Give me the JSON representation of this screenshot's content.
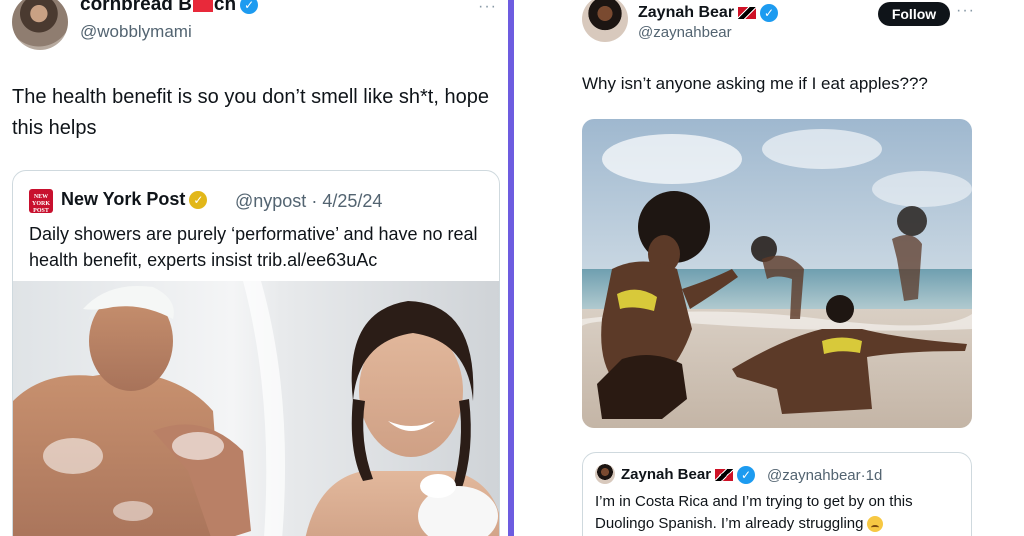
{
  "left_tweet": {
    "name_part1": "cornbread B",
    "name_part2": "ch",
    "handle": "@wobblymami",
    "more": "···",
    "text": "The health benefit is so you don’t smell like sh*t, hope this helps",
    "quote": {
      "logo_text": "NEW YORK POST",
      "name": "New York Post",
      "handle": "@nypost",
      "date": "4/25/24",
      "text": "Daily showers are purely ‘performative’ and have no real health benefit, experts insist trib.al/ee63uAc"
    }
  },
  "right_tweet": {
    "name": "Zaynah Bear",
    "handle": "@zaynahbear",
    "follow_label": "Follow",
    "more": "···",
    "text": "Why isn’t anyone asking me if I eat apples???",
    "quote": {
      "name": "Zaynah Bear",
      "handle": "@zaynahbear",
      "age": "1d",
      "text": "I’m in Costa Rica and I’m trying to get by on this Duolingo Spanish. I’m already struggling"
    }
  },
  "colors": {
    "divider": "#6d5ce0",
    "verified": "#1d9bf0",
    "nypost_red": "#c8102e",
    "gold_badge": "#e2b719",
    "redaction": "#e8293a"
  },
  "icons": [
    "verified-badge-icon",
    "gold-verified-icon",
    "flag-icon",
    "more-options-icon",
    "crying-face-emoji-icon"
  ]
}
